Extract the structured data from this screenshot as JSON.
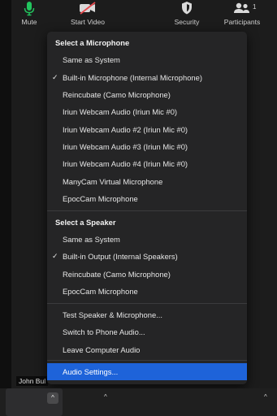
{
  "participant_name": "John Bul",
  "menu": {
    "microphone_header": "Select a Microphone",
    "microphones": [
      {
        "label": "Same as System",
        "checked": false
      },
      {
        "label": "Built-in Microphone (Internal Microphone)",
        "checked": true
      },
      {
        "label": "Reincubate (Camo Microphone)",
        "checked": false
      },
      {
        "label": "Iriun Webcam Audio (Iriun Mic #0)",
        "checked": false
      },
      {
        "label": "Iriun Webcam Audio #2 (Iriun Mic #0)",
        "checked": false
      },
      {
        "label": "Iriun Webcam Audio #3 (Iriun Mic #0)",
        "checked": false
      },
      {
        "label": "Iriun Webcam Audio #4 (Iriun Mic #0)",
        "checked": false
      },
      {
        "label": "ManyCam Virtual Microphone",
        "checked": false
      },
      {
        "label": "EpocCam Microphone",
        "checked": false
      }
    ],
    "speaker_header": "Select a Speaker",
    "speakers": [
      {
        "label": "Same as System",
        "checked": false
      },
      {
        "label": "Built-in Output (Internal Speakers)",
        "checked": true
      },
      {
        "label": "Reincubate (Camo Microphone)",
        "checked": false
      },
      {
        "label": "EpocCam Microphone",
        "checked": false
      }
    ],
    "actions": [
      {
        "label": "Test Speaker & Microphone..."
      },
      {
        "label": "Switch to Phone Audio..."
      },
      {
        "label": "Leave Computer Audio"
      }
    ],
    "audio_settings": "Audio Settings...",
    "check_glyph": "✓"
  },
  "toolbar": {
    "mute_label": "Mute",
    "start_video_label": "Start Video",
    "security_label": "Security",
    "participants_label": "Participants",
    "participants_count": "1",
    "mic_icon": "microphone-icon",
    "video_icon": "video-off-icon",
    "security_icon": "shield-icon",
    "participants_icon": "people-icon",
    "mic_color": "#22c55e",
    "selection_color": "#1e63d9"
  }
}
